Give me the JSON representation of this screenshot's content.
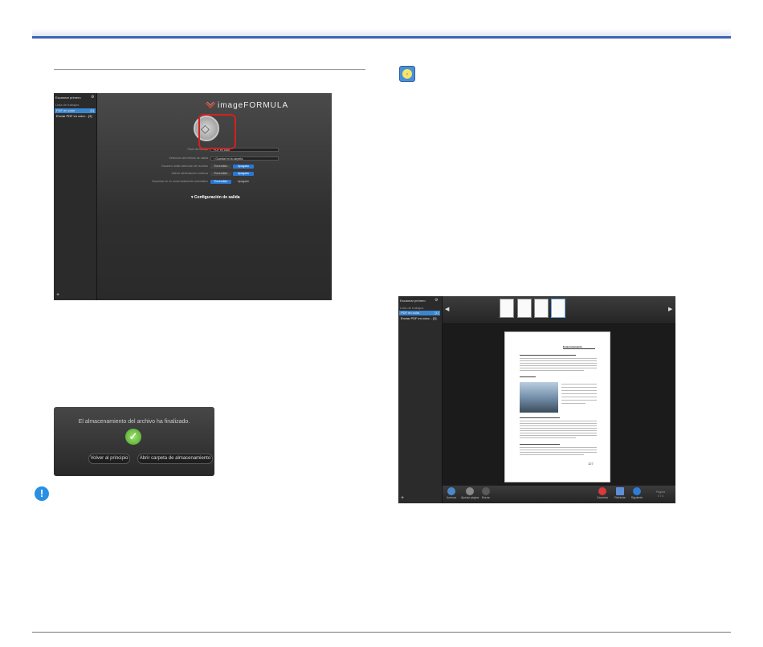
{
  "app": {
    "brand": "imageFORMULA",
    "sidebar_title": "Escanear primero",
    "sidebar_group": "Lista de trabajos",
    "jobs": [
      {
        "label": "PDF en color",
        "count": "[1]"
      },
      {
        "label": "Enviar PDF en color...",
        "count": "[3]"
      }
    ]
  },
  "scan_settings": {
    "fields": [
      {
        "label": "Título del trabajo",
        "value": "PDF en color"
      },
      {
        "label": "Selección del método de salida",
        "value": "Guardar en la carpeta"
      }
    ],
    "toggles": [
      {
        "label": "Escaneo doble-detección de recortes",
        "on": "Encendido",
        "off": "Apagado"
      },
      {
        "label": "Activar alimentación continua",
        "on": "Encendido",
        "off": "Apagado"
      },
      {
        "label": "Escanear en un modo totalmente automático",
        "on": "Encendido",
        "off": "Apagado"
      }
    ],
    "output_config": "Configuración de salida"
  },
  "dialog": {
    "message": "El almacenamiento del archivo ha finalizado.",
    "back_button": "Volver al principio",
    "open_folder_button": "Abrir carpeta de almacenamiento"
  },
  "viewer": {
    "page_title": "Estacionamiento",
    "page_number": "127",
    "toolbar": [
      "Acercar",
      "Ajustar página",
      "Borrar",
      "Cancelar",
      "Reiniciar",
      "Siguiente"
    ],
    "page_indicator_label": "Página",
    "page_indicator_value": "4 / 4"
  },
  "colors": {
    "accent": "#3d63b4",
    "highlight": "#d42020",
    "success": "#5db83a"
  }
}
